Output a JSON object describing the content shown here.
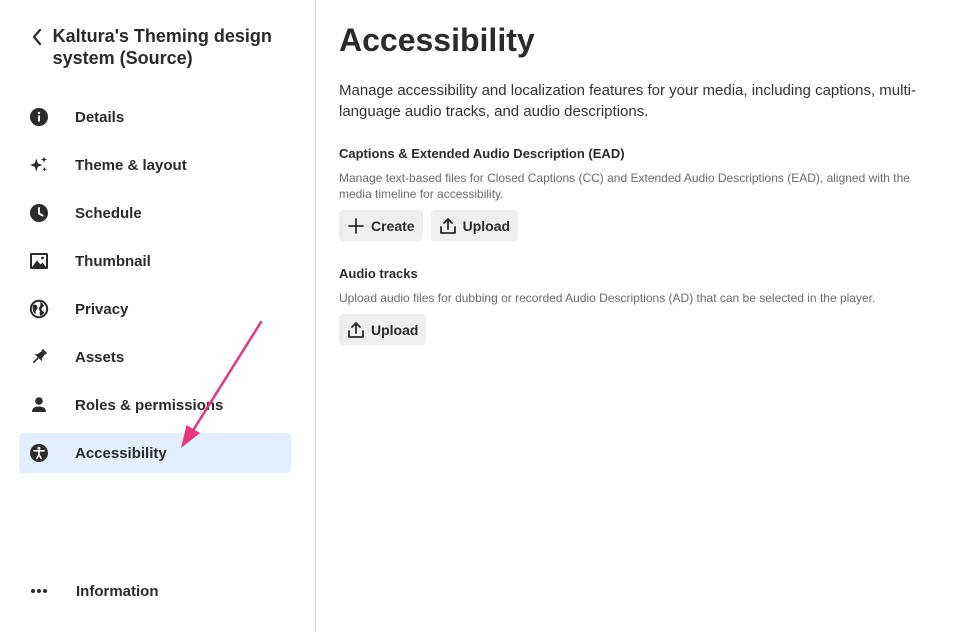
{
  "sidebar": {
    "entry_title": "Kaltura's Theming design system (Source)",
    "items": [
      {
        "label": "Details",
        "icon": "info-icon"
      },
      {
        "label": "Theme & layout",
        "icon": "sparkles-icon"
      },
      {
        "label": "Schedule",
        "icon": "clock-icon"
      },
      {
        "label": "Thumbnail",
        "icon": "image-icon"
      },
      {
        "label": "Privacy",
        "icon": "globe-icon"
      },
      {
        "label": "Assets",
        "icon": "pin-icon"
      },
      {
        "label": "Roles & permissions",
        "icon": "person-icon"
      },
      {
        "label": "Accessibility",
        "icon": "accessibility-icon",
        "active": true
      }
    ],
    "information_label": "Information"
  },
  "main": {
    "title": "Accessibility",
    "description": "Manage accessibility and localization features for your media, including captions, multi-language audio tracks, and audio descriptions.",
    "captions": {
      "title": "Captions & Extended Audio Description (EAD)",
      "description": "Manage text-based files for Closed Captions (CC) and Extended Audio Descriptions (EAD), aligned with the media timeline for accessibility.",
      "create_label": "Create",
      "upload_label": "Upload"
    },
    "audio": {
      "title": "Audio tracks",
      "description": "Upload audio files for dubbing or recorded Audio Descriptions (AD) that can be selected in the player.",
      "upload_label": "Upload"
    }
  },
  "colors": {
    "active_bg": "#e1efff",
    "annotation_arrow": "#e8357f",
    "button_bg": "#efefef"
  }
}
